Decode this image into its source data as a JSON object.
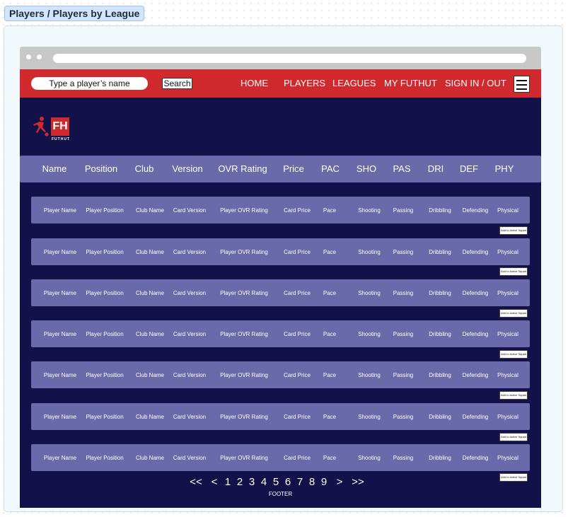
{
  "frame": {
    "title": "Players / Players by League"
  },
  "nav": {
    "search_placeholder": "Type a player’s name",
    "search_button": "Search",
    "links": [
      "HOME",
      "PLAYERS",
      "LEAGUES",
      "MY FUTHUT",
      "SIGN IN / OUT"
    ],
    "menu_icon": "hamburger-icon"
  },
  "logo": {
    "mark": "FH",
    "wordmark": "FUTHUT",
    "icon": "soccer-player-icon"
  },
  "table": {
    "headers": [
      "Name",
      "Position",
      "Club",
      "Version",
      "OVR Rating",
      "Price",
      "PAC",
      "SHO",
      "PAS",
      "DRI",
      "DEF",
      "PHY"
    ],
    "row_cells": [
      "Player Name",
      "Player Position",
      "Club Name",
      "Card Version",
      "Player OVR Rating",
      "Card Price",
      "Pace",
      "Shooting",
      "Passing",
      "Dribbling",
      "Defending",
      "Physical"
    ],
    "rows": [
      {
        "cells": [
          "Player Name",
          "Player Position",
          "Club Name",
          "Card Version",
          "Player OVR Rating",
          "Card Price",
          "Pace",
          "Shooting",
          "Passing",
          "Dribbling",
          "Defending",
          "Physical"
        ],
        "action": "Add to Active Squad"
      },
      {
        "cells": [
          "Player Name",
          "Player Position",
          "Club Name",
          "Card Version",
          "Player OVR Rating",
          "Card Price",
          "Pace",
          "Shooting",
          "Passing",
          "Dribbling",
          "Defending",
          "Physical"
        ],
        "action": "Add to Active Squad"
      },
      {
        "cells": [
          "Player Name",
          "Player Position",
          "Club Name",
          "Card Version",
          "Player OVR Rating",
          "Card Price",
          "Pace",
          "Shooting",
          "Passing",
          "Dribbling",
          "Defending",
          "Physical"
        ],
        "action": "Add to Active Squad"
      },
      {
        "cells": [
          "Player Name",
          "Player Position",
          "Club Name",
          "Card Version",
          "Player OVR Rating",
          "Card Price",
          "Pace",
          "Shooting",
          "Passing",
          "Dribbling",
          "Defending",
          "Physical"
        ],
        "action": "Add to Active Squad"
      },
      {
        "cells": [
          "Player Name",
          "Player Position",
          "Club Name",
          "Card Version",
          "Player OVR Rating",
          "Card Price",
          "Pace",
          "Shooting",
          "Passing",
          "Dribbling",
          "Defending",
          "Physical"
        ],
        "action": "Add to Active Squad"
      },
      {
        "cells": [
          "Player Name",
          "Player Position",
          "Club Name",
          "Card Version",
          "Player OVR Rating",
          "Card Price",
          "Pace",
          "Shooting",
          "Passing",
          "Dribbling",
          "Defending",
          "Physical"
        ],
        "action": "Add to Active Squad"
      },
      {
        "cells": [
          "Player Name",
          "Player Position",
          "Club Name",
          "Card Version",
          "Player OVR Rating",
          "Card Price",
          "Pace",
          "Shooting",
          "Passing",
          "Dribbling",
          "Defending",
          "Physical"
        ],
        "action": "Add to Active Squad"
      }
    ]
  },
  "pagination": {
    "items": [
      "<<",
      "<",
      "1",
      "2",
      "3",
      "4",
      "5",
      "6",
      "7",
      "8",
      "9",
      ">",
      ">>"
    ]
  },
  "footer": {
    "text": "FOOTER"
  },
  "colors": {
    "navbar": "#d02a2e",
    "page_bg": "#13114a",
    "row_bg": "#6a6aab",
    "frame_bg": "#f2f9fd"
  }
}
